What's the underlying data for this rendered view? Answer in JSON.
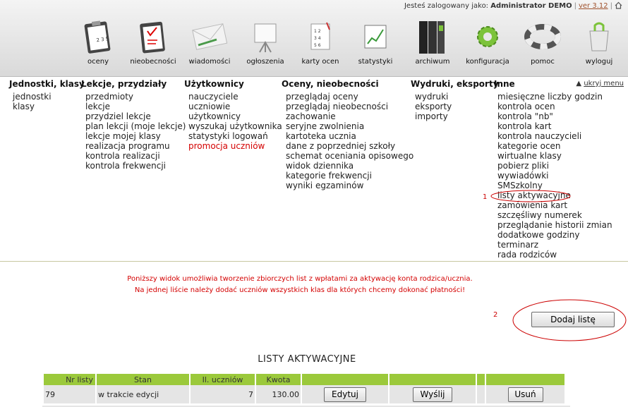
{
  "header": {
    "logged_prefix": "Jesteś zalogowany jako:",
    "user": "Administrator DEMO",
    "version": "ver 3.12",
    "nav": [
      {
        "label": "oceny",
        "icon": "clipboard-grades-icon"
      },
      {
        "label": "nieobecności",
        "icon": "clipboard-absence-icon"
      },
      {
        "label": "wiadomości",
        "icon": "envelope-icon"
      },
      {
        "label": "ogłoszenia",
        "icon": "easel-board-icon"
      },
      {
        "label": "karty ocen",
        "icon": "grade-card-icon"
      },
      {
        "label": "statystyki",
        "icon": "chart-icon"
      },
      {
        "label": "archiwum",
        "icon": "binders-icon"
      },
      {
        "label": "konfiguracja",
        "icon": "gear-icon"
      },
      {
        "label": "pomoc",
        "icon": "lifebuoy-icon"
      },
      {
        "label": "wyloguj",
        "icon": "logout-bag-icon"
      }
    ]
  },
  "menu": {
    "hide_label": "ukryj menu",
    "columns": [
      {
        "title": "Jednostki, klasy",
        "items": [
          "jednostki",
          "klasy"
        ]
      },
      {
        "title": "Lekcje, przydziały",
        "items": [
          "przedmioty",
          "lekcje",
          "przydziel lekcje",
          "plan lekcji (moje lekcje)",
          "lekcje mojej klasy",
          "realizacja programu",
          "kontrola realizacji",
          "kontrola frekwencji"
        ]
      },
      {
        "title": "Użytkownicy",
        "items": [
          "nauczyciele",
          "uczniowie",
          "użytkownicy",
          "wyszukaj użytkownika",
          "statystyki logowań",
          "promocja uczniów"
        ]
      },
      {
        "title": "Oceny, nieobecności",
        "items": [
          "przeglądaj oceny",
          "przeglądaj nieobecności",
          "zachowanie",
          "seryjne zwolnienia",
          "kartoteka ucznia",
          "dane z poprzedniej szkoły",
          "schemat oceniania opisowego",
          "widok dziennika",
          "kategorie frekwencji",
          "wyniki egzaminów"
        ]
      },
      {
        "title": "Wydruki, eksporty",
        "items": [
          "wydruki",
          "eksporty",
          "importy"
        ]
      },
      {
        "title": "Inne",
        "items": [
          "miesięczne liczby godzin",
          "kontrola ocen",
          "kontrola \"nb\"",
          "kontrola kart",
          "kontrola nauczycieli",
          "kategorie ocen",
          "wirtualne klasy",
          "pobierz pliki",
          "wywiadówki",
          "SMSzkolny",
          "listy aktywacyjne",
          "zamówienia kart",
          "szczęśliwy numerek",
          "przeglądanie historii zmian",
          "dodatkowe godziny",
          "terminarz",
          "rada rodziców"
        ]
      }
    ]
  },
  "info": {
    "line1": "Poniższy widok umożliwia tworzenie zbiorczych list z wpłatami za aktywację konta rodzica/ucznia.",
    "line2": "Na jednej liście należy dodać uczniów wszystkich klas dla których chcemy dokonać płatności!"
  },
  "annotations": {
    "a1": "1",
    "a2": "2"
  },
  "add_button": "Dodaj listę",
  "section_title": "LISTY AKTYWACYJNE",
  "table": {
    "headers": [
      "Nr listy",
      "Stan",
      "Il. uczniów",
      "Kwota",
      "",
      "",
      "",
      ""
    ],
    "rows": [
      {
        "nr": "79",
        "stan": "w trakcie edycji",
        "il": "7",
        "kwota": "130.00",
        "edit": "Edytuj",
        "send": "Wyślij",
        "remove": "Usuń"
      }
    ]
  },
  "colors": {
    "accent_green": "#9bc93b",
    "warning_red": "#d40000",
    "version_link": "#a0522d"
  }
}
